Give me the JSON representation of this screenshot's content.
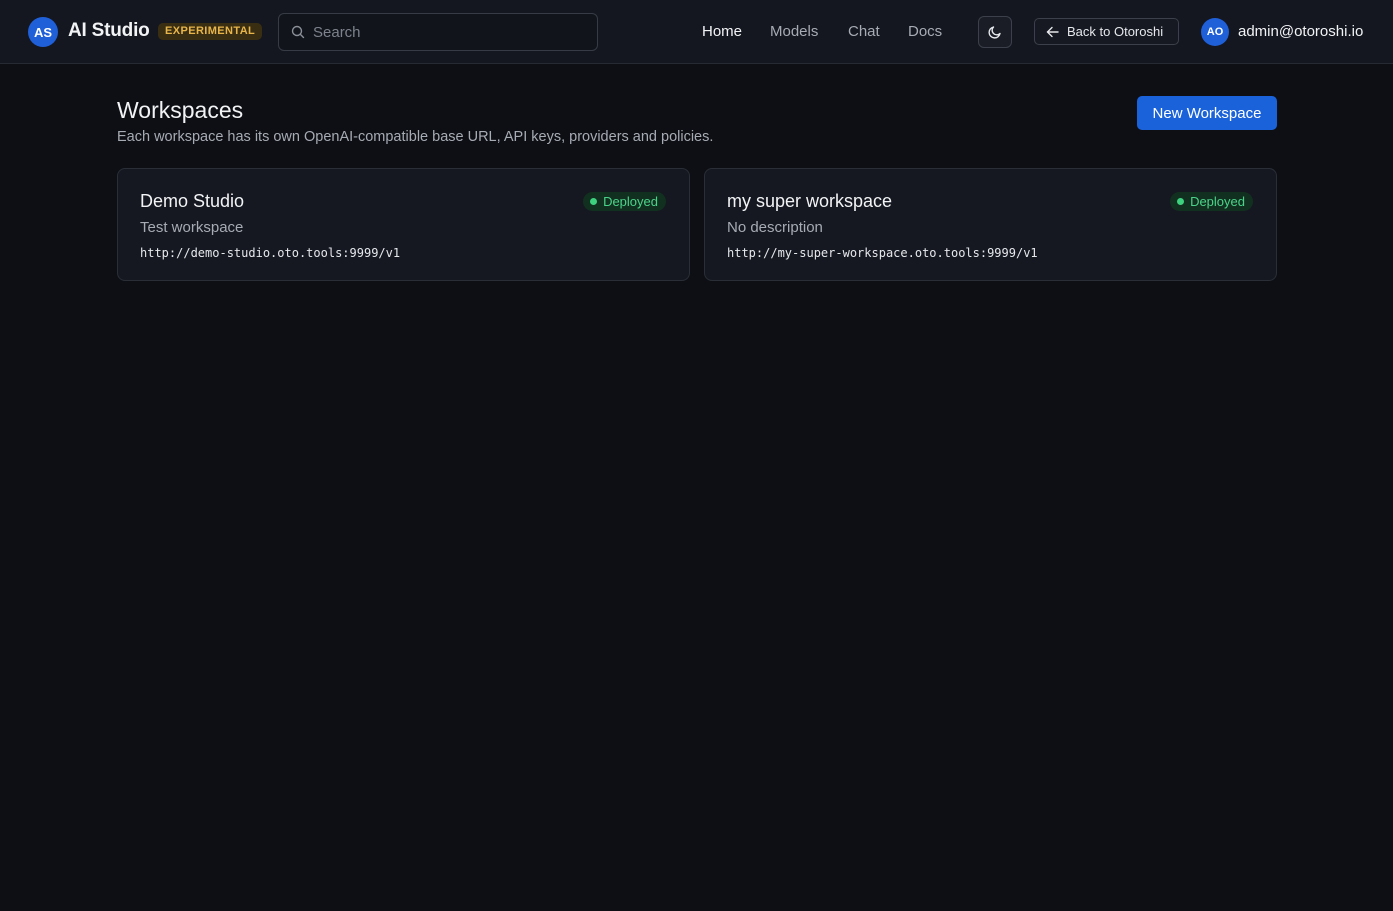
{
  "app": {
    "logo_initials": "AS",
    "title": "AI Studio",
    "tag": "EXPERIMENTAL"
  },
  "search": {
    "placeholder": "Search",
    "value": "",
    "icon": "search-icon"
  },
  "nav": {
    "items": [
      {
        "label": "Home",
        "active": true
      },
      {
        "label": "Models",
        "active": false
      },
      {
        "label": "Chat",
        "active": false
      },
      {
        "label": "Docs",
        "active": false
      }
    ]
  },
  "theme_toggle": {
    "icon": "moon-icon"
  },
  "back_button": {
    "label": "Back to Otoroshi",
    "icon": "arrow-left-icon"
  },
  "user": {
    "initials": "AO",
    "email": "admin@otoroshi.io"
  },
  "main": {
    "title": "Workspaces",
    "subtitle": "Each workspace has its own OpenAI-compatible base URL, API keys, providers and policies.",
    "new_button": "New Workspace",
    "workspaces": [
      {
        "name": "Demo Studio",
        "description": "Test workspace",
        "url": "http://demo-studio.oto.tools:9999/v1",
        "status": "Deployed"
      },
      {
        "name": "my super workspace",
        "description": "No description",
        "url": "http://my-super-workspace.oto.tools:9999/v1",
        "status": "Deployed"
      }
    ]
  },
  "colors": {
    "background": "#0d0f14",
    "topbar": "#141720",
    "accent": "#1a62d9",
    "tag_text": "#e7b54a",
    "status_green": "#4ad48a"
  }
}
